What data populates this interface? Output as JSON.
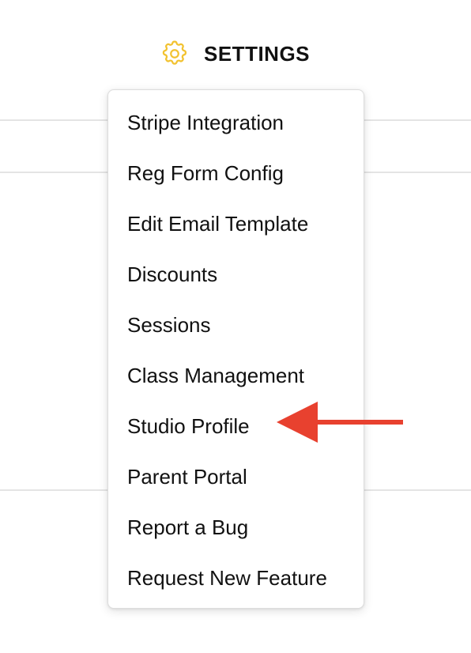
{
  "header": {
    "title": "SETTINGS",
    "icon": "gear-icon",
    "icon_color": "#f2c230"
  },
  "menu": {
    "items": [
      {
        "label": "Stripe Integration"
      },
      {
        "label": "Reg Form Config"
      },
      {
        "label": "Edit Email Template"
      },
      {
        "label": "Discounts"
      },
      {
        "label": "Sessions"
      },
      {
        "label": "Class Management"
      },
      {
        "label": "Studio Profile"
      },
      {
        "label": "Parent Portal"
      },
      {
        "label": "Report a Bug"
      },
      {
        "label": "Request New Feature"
      }
    ]
  },
  "annotation": {
    "arrow_color": "#e8412f",
    "points_to": "Studio Profile"
  }
}
